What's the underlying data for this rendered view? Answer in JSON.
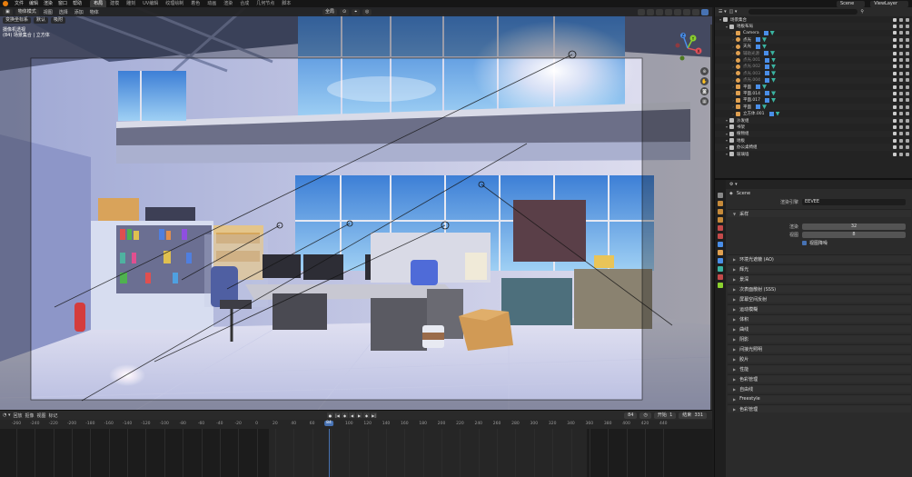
{
  "topbar": {
    "menus": [
      "文件",
      "编辑",
      "渲染",
      "窗口",
      "帮助"
    ],
    "workspaces": [
      "布局",
      "建模",
      "雕刻",
      "UV编辑",
      "纹理绘制",
      "着色",
      "动画",
      "渲染",
      "合成",
      "几何节点",
      "脚本"
    ],
    "active_workspace": "布局",
    "scene": "Scene",
    "view_layer": "ViewLayer"
  },
  "viewport": {
    "header": {
      "mode": "物体模式",
      "menus": [
        "视图",
        "选择",
        "添加",
        "物体"
      ],
      "transform": "全局"
    },
    "sub": {
      "orientation": "变换坐标系",
      "default": "默认",
      "snap": "吸附"
    },
    "info_line1": "摄像机透视",
    "info_line2": "(84) 场景集合 | 立方体"
  },
  "gizmo": {
    "x": "X",
    "y": "Y",
    "z": "Z"
  },
  "timeline": {
    "menus": [
      "回放",
      "抠像",
      "视图",
      "标记"
    ],
    "current_frame": "84",
    "start_label": "开始",
    "start": "1",
    "end_label": "结束",
    "end": "331",
    "ticks": [
      "-260",
      "-240",
      "-220",
      "-200",
      "-180",
      "-160",
      "-140",
      "-120",
      "-100",
      "-80",
      "-60",
      "-40",
      "-20",
      "0",
      "20",
      "40",
      "60",
      "80",
      "100",
      "120",
      "140",
      "160",
      "180",
      "200",
      "220",
      "240",
      "260",
      "280",
      "300",
      "320",
      "340",
      "360",
      "380",
      "400",
      "420",
      "440"
    ]
  },
  "outliner": {
    "rows": [
      {
        "name": "场景集合",
        "icon": "collection-icon",
        "color": "#d0d0d0",
        "indent": 0,
        "dim": false
      },
      {
        "name": "地板布局",
        "icon": "collection-icon",
        "color": "#d0d0d0",
        "indent": 1,
        "dim": false
      },
      {
        "name": "Camera",
        "icon": "camera-icon",
        "color": "#e0a050",
        "indent": 2,
        "dim": false
      },
      {
        "name": "点光",
        "icon": "light-icon",
        "color": "#e0a050",
        "indent": 2,
        "dim": false
      },
      {
        "name": "天光",
        "icon": "light-icon",
        "color": "#e0a050",
        "indent": 2,
        "dim": false
      },
      {
        "name": "辅助光源",
        "icon": "light-icon",
        "color": "#e0a050",
        "indent": 2,
        "dim": true
      },
      {
        "name": "点光.001",
        "icon": "light-icon",
        "color": "#e0a050",
        "indent": 2,
        "dim": true
      },
      {
        "name": "点光.002",
        "icon": "light-icon",
        "color": "#e0a050",
        "indent": 2,
        "dim": true
      },
      {
        "name": "点光.003",
        "icon": "light-icon",
        "color": "#e0a050",
        "indent": 2,
        "dim": true
      },
      {
        "name": "点光.004",
        "icon": "light-icon",
        "color": "#e0a050",
        "indent": 2,
        "dim": true
      },
      {
        "name": "平面",
        "icon": "mesh-icon",
        "color": "#e0a050",
        "indent": 2,
        "dim": false
      },
      {
        "name": "平面.014",
        "icon": "mesh-icon",
        "color": "#e0a050",
        "indent": 2,
        "dim": false
      },
      {
        "name": "平面.017",
        "icon": "mesh-icon",
        "color": "#e0a050",
        "indent": 2,
        "dim": false
      },
      {
        "name": "平面",
        "icon": "mesh-icon",
        "color": "#e0a050",
        "indent": 2,
        "dim": false
      },
      {
        "name": "立方体.001",
        "icon": "mesh-icon",
        "color": "#e0a050",
        "indent": 2,
        "dim": false
      },
      {
        "name": "沙发组",
        "icon": "collection-icon",
        "color": "#d0d0d0",
        "indent": 1,
        "dim": false
      },
      {
        "name": "书架",
        "icon": "collection-icon",
        "color": "#d0d0d0",
        "indent": 1,
        "dim": false
      },
      {
        "name": "植物组",
        "icon": "collection-icon",
        "color": "#d0d0d0",
        "indent": 1,
        "dim": false
      },
      {
        "name": "地板",
        "icon": "collection-icon",
        "color": "#d0d0d0",
        "indent": 1,
        "dim": false
      },
      {
        "name": "办公桌椅组",
        "icon": "collection-icon",
        "color": "#d0d0d0",
        "indent": 1,
        "dim": false
      },
      {
        "name": "玻璃墙",
        "icon": "collection-icon",
        "color": "#d0d0d0",
        "indent": 1,
        "dim": false
      }
    ]
  },
  "properties": {
    "crumb": "Scene",
    "engine_label": "渲染引擎",
    "engine": "EEVEE",
    "sampling_title": "采样",
    "render_label": "渲染",
    "render_value": "32",
    "viewport_label": "视图",
    "viewport_value": "8",
    "denoise_label": "视图降噪",
    "panels": [
      "环境光遮蔽 (AO)",
      "辉光",
      "景深",
      "次表面散射 (SSS)",
      "屏幕空间反射",
      "运动模糊",
      "体积",
      "曲线",
      "阴影",
      "间接光照明",
      "胶片",
      "性能",
      "色彩管理",
      "自由线",
      "Freestyle",
      "色彩管理"
    ]
  },
  "colors": {
    "accent": "#4772b3",
    "blender_orange": "#e87d0d",
    "axis_x": "#e0505a",
    "axis_y": "#8bd12f",
    "axis_z": "#4a8ee8"
  }
}
